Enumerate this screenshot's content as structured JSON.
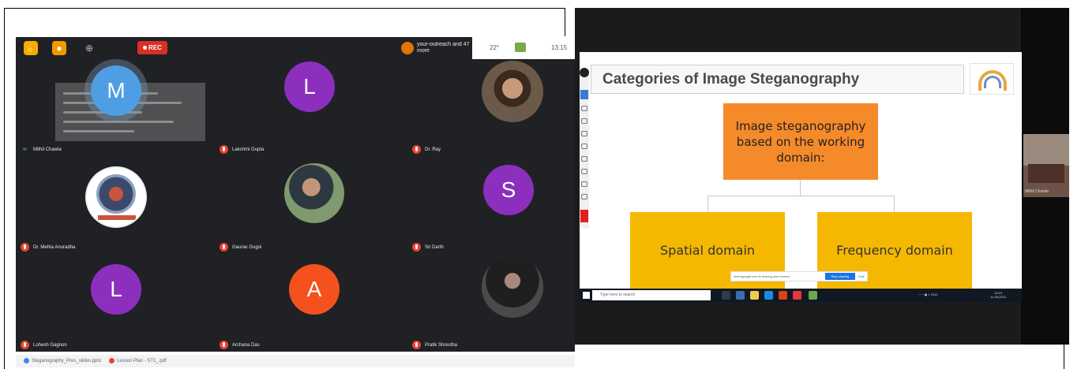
{
  "meeting": {
    "rec_label": "REC",
    "cast_text": "your-outreach and 47 more",
    "top_right": {
      "temp": "22°",
      "time": "13:15"
    },
    "participants": [
      {
        "name": "Mithil Chawla",
        "initial": "M",
        "color": "#4f9ee3",
        "mic": "on"
      },
      {
        "name": "Lakshmi Gupta",
        "initial": "L",
        "color": "#8c2fbf",
        "mic": "off"
      },
      {
        "name": "Dr. Ray",
        "initial": "",
        "color": "#3a2a1d",
        "mic": "off"
      },
      {
        "name": "Dr. Mehta Anuradha",
        "initial": "",
        "color": "#ffffff",
        "mic": "off"
      },
      {
        "name": "Gaurav Gogoi",
        "initial": "",
        "color": "#5d6e7a",
        "mic": "off"
      },
      {
        "name": "Sri Darth",
        "initial": "S",
        "color": "#8c2fbf",
        "mic": "off"
      },
      {
        "name": "Lohesh Gagnon",
        "initial": "L",
        "color": "#8c2fbf",
        "mic": "off"
      },
      {
        "name": "Archana Das",
        "initial": "A",
        "color": "#f4511e",
        "mic": "off"
      },
      {
        "name": "Pratik Shrestha",
        "initial": "",
        "color": "#2c2c2c",
        "mic": "off"
      }
    ],
    "bottom_tabs": [
      "Steganography_Pres_slides.pptx",
      "Lesson Plan - ST1_.pdf"
    ]
  },
  "slide": {
    "title": "Categories of Image Steganography",
    "main_box": "Image steganography based on the working domain:",
    "left_box": "Spatial domain",
    "right_box": "Frequency domain"
  },
  "share_bar": {
    "text": "meet.google.com is sharing your screen.",
    "stop_label": "Stop sharing",
    "hide_label": "Hide"
  },
  "taskbar": {
    "search_placeholder": "Type here to search",
    "clock_time": "13:15",
    "clock_date": "11-08-2021"
  },
  "camera_thumb": {
    "label": "Mithil Chawla"
  }
}
